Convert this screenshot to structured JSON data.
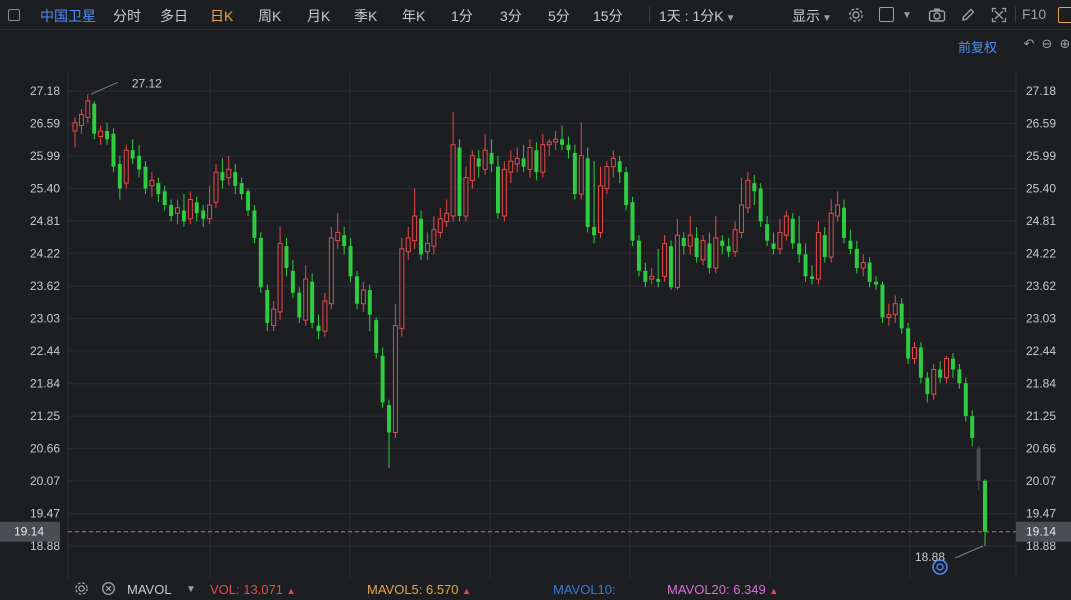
{
  "toolbar": {
    "stock_name": "中国卫星",
    "periods": [
      "分时",
      "多日",
      "日K",
      "周K",
      "月K",
      "季K",
      "年K",
      "1分",
      "3分",
      "5分",
      "15分"
    ],
    "active_period": "日K",
    "interval_label": "1天 : 1分K",
    "display_label": "显示",
    "f10_label": "F10"
  },
  "chart": {
    "restore_label": "前复权",
    "price_ticks": [
      "27.18",
      "26.59",
      "25.99",
      "25.40",
      "24.81",
      "24.22",
      "23.62",
      "23.03",
      "22.44",
      "21.84",
      "21.25",
      "20.66",
      "20.07",
      "19.47",
      "18.88"
    ],
    "current_price_label": "19.14",
    "high_label": "27.12",
    "low_label": "18.88",
    "colors": {
      "up": "#e84a4a",
      "down": "#2ecc40",
      "current": "#4a4d52",
      "grid": "#2a2d32"
    }
  },
  "chart_data": {
    "type": "candlestick",
    "ylim": [
      18.88,
      27.18
    ],
    "candles": [
      [
        26.45,
        26.6,
        26.15,
        26.7
      ],
      [
        26.55,
        26.75,
        26.4,
        26.85
      ],
      [
        26.7,
        27.0,
        26.6,
        27.12
      ],
      [
        26.95,
        26.4,
        26.3,
        27.0
      ],
      [
        26.35,
        26.45,
        26.2,
        26.55
      ],
      [
        26.45,
        26.3,
        26.2,
        26.6
      ],
      [
        26.4,
        25.8,
        25.7,
        26.5
      ],
      [
        25.85,
        25.4,
        25.2,
        26.0
      ],
      [
        25.5,
        26.1,
        25.4,
        26.2
      ],
      [
        26.1,
        25.95,
        25.85,
        26.3
      ],
      [
        26.0,
        25.75,
        25.6,
        26.2
      ],
      [
        25.8,
        25.4,
        25.3,
        25.9
      ],
      [
        25.45,
        25.55,
        25.25,
        25.7
      ],
      [
        25.5,
        25.3,
        25.15,
        25.6
      ],
      [
        25.35,
        25.1,
        25.0,
        25.45
      ],
      [
        25.1,
        24.9,
        24.8,
        25.2
      ],
      [
        24.95,
        25.05,
        24.75,
        25.2
      ],
      [
        25.0,
        24.8,
        24.7,
        25.3
      ],
      [
        24.85,
        25.2,
        24.75,
        25.35
      ],
      [
        25.15,
        24.95,
        24.8,
        25.25
      ],
      [
        25.0,
        24.85,
        24.7,
        25.1
      ],
      [
        24.85,
        25.1,
        24.75,
        25.45
      ],
      [
        25.15,
        25.7,
        25.05,
        25.85
      ],
      [
        25.7,
        25.55,
        25.4,
        25.95
      ],
      [
        25.6,
        25.75,
        25.45,
        26.0
      ],
      [
        25.7,
        25.45,
        25.3,
        25.85
      ],
      [
        25.5,
        25.3,
        25.2,
        25.6
      ],
      [
        25.35,
        25.0,
        24.9,
        25.4
      ],
      [
        25.0,
        24.5,
        24.4,
        25.1
      ],
      [
        24.5,
        23.6,
        23.5,
        24.6
      ],
      [
        23.55,
        22.95,
        22.8,
        23.65
      ],
      [
        22.9,
        23.2,
        22.8,
        23.35
      ],
      [
        23.15,
        24.4,
        23.0,
        24.7
      ],
      [
        24.35,
        23.95,
        23.8,
        24.5
      ],
      [
        23.9,
        23.5,
        23.4,
        24.1
      ],
      [
        23.5,
        23.05,
        22.95,
        23.6
      ],
      [
        23.0,
        23.75,
        22.9,
        24.0
      ],
      [
        23.7,
        22.95,
        22.85,
        23.85
      ],
      [
        22.9,
        22.8,
        22.65,
        23.1
      ],
      [
        22.8,
        23.35,
        22.7,
        23.5
      ],
      [
        23.3,
        24.5,
        23.2,
        24.7
      ],
      [
        24.45,
        24.6,
        24.3,
        24.95
      ],
      [
        24.55,
        24.35,
        24.2,
        24.7
      ],
      [
        24.35,
        23.8,
        23.7,
        24.5
      ],
      [
        23.8,
        23.3,
        23.2,
        23.9
      ],
      [
        23.3,
        23.55,
        23.15,
        23.7
      ],
      [
        23.55,
        23.1,
        22.8,
        23.65
      ],
      [
        23.0,
        22.4,
        22.3,
        23.05
      ],
      [
        22.35,
        21.5,
        21.4,
        22.5
      ],
      [
        21.45,
        20.95,
        20.3,
        21.55
      ],
      [
        20.95,
        22.9,
        20.85,
        23.3
      ],
      [
        22.85,
        24.3,
        22.7,
        24.5
      ],
      [
        24.25,
        24.5,
        24.1,
        24.7
      ],
      [
        24.45,
        24.9,
        24.3,
        25.4
      ],
      [
        24.85,
        24.2,
        24.1,
        25.0
      ],
      [
        24.25,
        24.4,
        24.1,
        24.6
      ],
      [
        24.35,
        24.65,
        24.2,
        24.9
      ],
      [
        24.6,
        24.85,
        24.5,
        25.05
      ],
      [
        24.8,
        24.95,
        24.7,
        25.2
      ],
      [
        24.9,
        26.2,
        24.8,
        26.8
      ],
      [
        26.15,
        24.9,
        24.8,
        26.3
      ],
      [
        24.9,
        25.6,
        24.8,
        25.8
      ],
      [
        25.55,
        26.0,
        25.4,
        26.1
      ],
      [
        25.95,
        25.8,
        25.6,
        26.1
      ],
      [
        25.75,
        26.1,
        25.65,
        26.4
      ],
      [
        26.05,
        25.85,
        25.7,
        26.3
      ],
      [
        25.8,
        24.95,
        24.85,
        26.0
      ],
      [
        24.9,
        25.75,
        24.8,
        25.9
      ],
      [
        25.7,
        25.9,
        25.5,
        26.1
      ],
      [
        25.85,
        25.95,
        25.7,
        26.15
      ],
      [
        25.95,
        25.8,
        25.7,
        26.2
      ],
      [
        25.75,
        26.15,
        25.6,
        26.3
      ],
      [
        26.1,
        25.7,
        25.55,
        26.25
      ],
      [
        25.7,
        26.2,
        25.6,
        26.4
      ],
      [
        26.2,
        26.25,
        26.0,
        26.3
      ],
      [
        26.25,
        26.3,
        26.1,
        26.45
      ],
      [
        26.3,
        26.2,
        26.1,
        26.55
      ],
      [
        26.2,
        26.1,
        25.95,
        26.35
      ],
      [
        26.05,
        25.3,
        25.2,
        26.2
      ],
      [
        25.3,
        26.0,
        25.2,
        26.6
      ],
      [
        25.95,
        24.7,
        24.6,
        26.15
      ],
      [
        24.7,
        24.55,
        24.4,
        25.9
      ],
      [
        24.6,
        25.45,
        24.5,
        25.8
      ],
      [
        25.4,
        25.8,
        25.3,
        25.9
      ],
      [
        25.8,
        25.95,
        25.6,
        26.1
      ],
      [
        25.9,
        25.7,
        25.5,
        26.0
      ],
      [
        25.7,
        25.1,
        25.0,
        25.8
      ],
      [
        25.15,
        24.45,
        24.35,
        25.25
      ],
      [
        24.45,
        23.9,
        23.8,
        24.55
      ],
      [
        23.9,
        23.7,
        23.6,
        24.05
      ],
      [
        23.75,
        23.8,
        23.65,
        23.95
      ],
      [
        23.75,
        23.7,
        23.6,
        24.3
      ],
      [
        23.8,
        24.4,
        23.7,
        24.55
      ],
      [
        24.35,
        23.6,
        23.55,
        24.45
      ],
      [
        23.6,
        24.55,
        23.55,
        24.85
      ],
      [
        24.5,
        24.35,
        24.2,
        24.6
      ],
      [
        24.35,
        24.55,
        24.2,
        24.9
      ],
      [
        24.5,
        24.15,
        24.05,
        24.7
      ],
      [
        24.1,
        24.45,
        24.0,
        24.55
      ],
      [
        24.4,
        23.95,
        23.85,
        24.6
      ],
      [
        23.95,
        24.5,
        23.85,
        24.9
      ],
      [
        24.45,
        24.35,
        24.2,
        24.55
      ],
      [
        24.35,
        24.25,
        24.15,
        24.5
      ],
      [
        24.25,
        24.65,
        24.15,
        24.8
      ],
      [
        24.6,
        25.1,
        24.5,
        25.6
      ],
      [
        25.05,
        25.55,
        24.95,
        25.7
      ],
      [
        25.5,
        25.35,
        25.1,
        25.65
      ],
      [
        25.4,
        24.8,
        24.7,
        25.5
      ],
      [
        24.75,
        24.45,
        24.35,
        24.9
      ],
      [
        24.4,
        24.3,
        24.2,
        24.6
      ],
      [
        24.3,
        24.6,
        24.2,
        24.85
      ],
      [
        24.55,
        24.9,
        24.45,
        25.0
      ],
      [
        24.85,
        24.4,
        24.3,
        24.95
      ],
      [
        24.4,
        24.2,
        24.05,
        24.9
      ],
      [
        24.2,
        23.8,
        23.7,
        24.4
      ],
      [
        23.8,
        23.75,
        23.65,
        24.0
      ],
      [
        23.75,
        24.6,
        23.65,
        24.8
      ],
      [
        24.55,
        24.15,
        24.05,
        24.7
      ],
      [
        24.15,
        24.95,
        24.05,
        25.2
      ],
      [
        24.9,
        25.1,
        24.8,
        25.35
      ],
      [
        25.05,
        24.5,
        24.4,
        25.2
      ],
      [
        24.45,
        24.3,
        24.2,
        24.65
      ],
      [
        24.3,
        23.95,
        23.85,
        24.45
      ],
      [
        23.95,
        24.05,
        23.8,
        24.2
      ],
      [
        24.05,
        23.7,
        23.6,
        24.15
      ],
      [
        23.7,
        23.65,
        23.55,
        23.8
      ],
      [
        23.65,
        23.05,
        22.95,
        23.7
      ],
      [
        23.05,
        23.1,
        22.9,
        23.3
      ],
      [
        23.1,
        23.3,
        22.95,
        23.45
      ],
      [
        23.3,
        22.85,
        22.75,
        23.4
      ],
      [
        22.85,
        22.3,
        22.2,
        22.95
      ],
      [
        22.3,
        22.5,
        22.2,
        22.6
      ],
      [
        22.5,
        21.95,
        21.85,
        22.6
      ],
      [
        21.95,
        21.65,
        21.5,
        22.05
      ],
      [
        21.65,
        22.1,
        21.55,
        22.2
      ],
      [
        22.1,
        21.95,
        21.85,
        22.25
      ],
      [
        21.95,
        22.3,
        21.85,
        22.35
      ],
      [
        22.3,
        22.1,
        21.95,
        22.4
      ],
      [
        22.1,
        21.85,
        21.75,
        22.2
      ],
      [
        21.85,
        21.25,
        21.15,
        21.95
      ],
      [
        21.25,
        20.85,
        20.7,
        21.35
      ],
      [
        20.66,
        20.07,
        19.9,
        20.7
      ],
      [
        20.07,
        19.14,
        18.88,
        20.1
      ]
    ]
  },
  "bottom": {
    "indicator_name": "MAVOL",
    "vol_label": "VOL: 13.071",
    "vol_arrow": "▲",
    "mavol5_label": "MAVOL5: 6.570",
    "mavol5_arrow": "▲",
    "mavol10_label": "MAVOL10:",
    "mavol20_label": "MAVOL20: 6.349",
    "mavol20_arrow": "▲",
    "colors": {
      "vol": "#e84a4a",
      "mavol5": "#e7a54a",
      "mavol10": "#3a7bd5",
      "mavol20": "#d86fd8"
    }
  }
}
